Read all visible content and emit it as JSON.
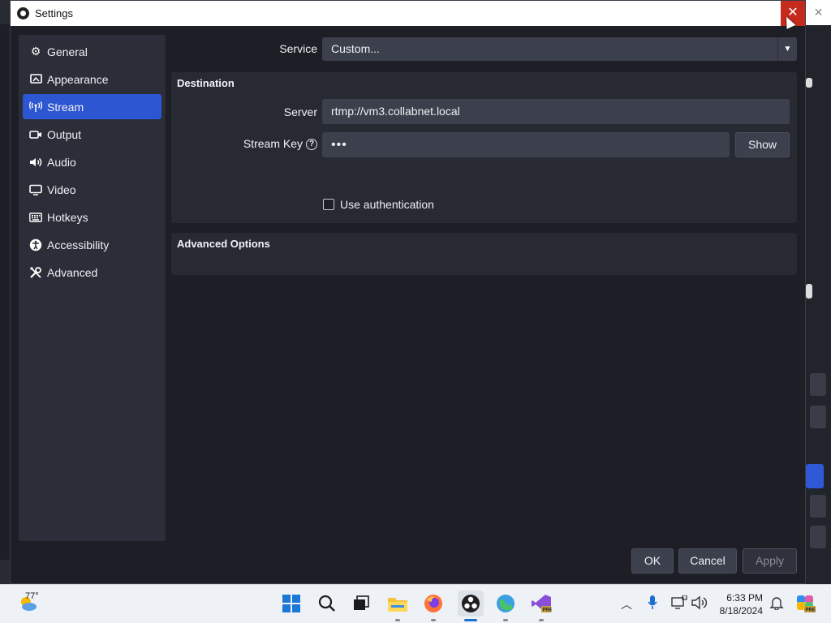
{
  "window": {
    "title": "Settings",
    "close_glyph": "✕"
  },
  "sidebar": {
    "items": [
      {
        "label": "General",
        "icon": "gear-icon",
        "glyph": "⚙"
      },
      {
        "label": "Appearance",
        "icon": "appearance-icon",
        "glyph": "▣"
      },
      {
        "label": "Stream",
        "icon": "antenna-icon",
        "glyph": "((•))"
      },
      {
        "label": "Output",
        "icon": "output-icon",
        "glyph": "▭"
      },
      {
        "label": "Audio",
        "icon": "speaker-icon",
        "glyph": "🔊"
      },
      {
        "label": "Video",
        "icon": "monitor-icon",
        "glyph": "▭"
      },
      {
        "label": "Hotkeys",
        "icon": "keyboard-icon",
        "glyph": "⌨"
      },
      {
        "label": "Accessibility",
        "icon": "accessibility-icon",
        "glyph": "♿"
      },
      {
        "label": "Advanced",
        "icon": "tools-icon",
        "glyph": "✕"
      }
    ],
    "active_index": 2
  },
  "stream": {
    "service_label": "Service",
    "service_value": "Custom...",
    "destination_title": "Destination",
    "server_label": "Server",
    "server_value": "rtmp://vm3.collabnet.local",
    "stream_key_label": "Stream Key",
    "stream_key_value": "•••",
    "show_button": "Show",
    "use_auth_label": "Use authentication",
    "use_auth_checked": false,
    "advanced_title": "Advanced Options"
  },
  "footer": {
    "ok": "OK",
    "cancel": "Cancel",
    "apply": "Apply"
  },
  "taskbar": {
    "weather_temp": "77°",
    "time": "6:33 PM",
    "date": "8/18/2024",
    "apps": [
      "start-icon",
      "search-icon",
      "task-view-icon",
      "file-explorer-icon",
      "firefox-icon",
      "obs-icon",
      "maps-icon",
      "visual-studio-icon"
    ]
  },
  "colors": {
    "accent": "#2d56d2",
    "close_red": "#c42b1c",
    "panel": "#272a33",
    "input": "#3c404d"
  }
}
